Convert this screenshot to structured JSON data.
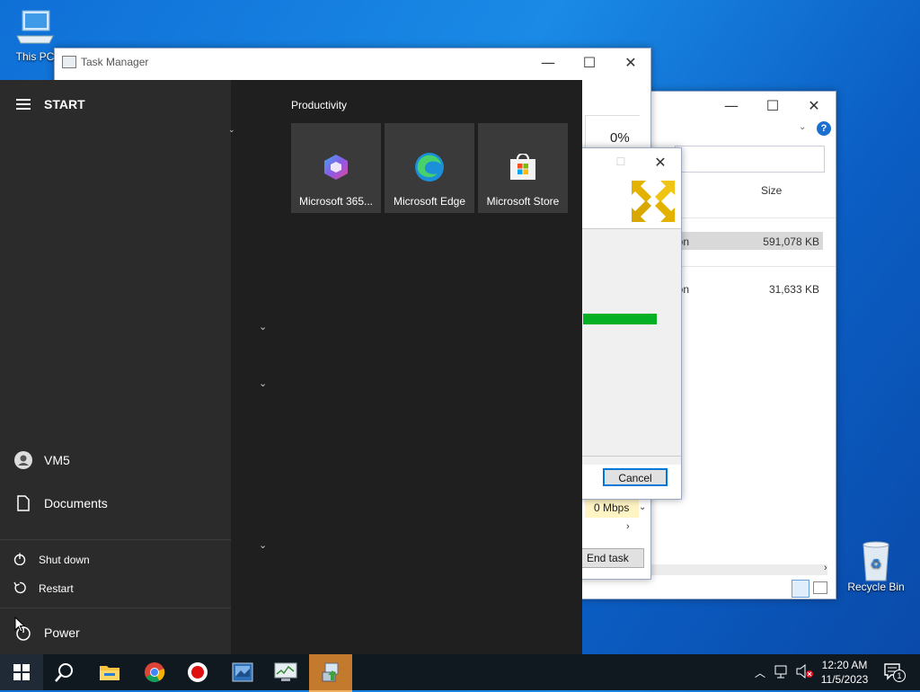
{
  "desktop": {
    "icons": [
      {
        "label": "This PC",
        "icon": "computer-icon"
      },
      {
        "label": "Recycle Bin",
        "icon": "recycle-bin-icon"
      }
    ]
  },
  "task_manager": {
    "title": "Task Manager",
    "cpu_percent": "0%",
    "network": "0 Mbps",
    "end_task_label": "End task"
  },
  "explorer": {
    "column_size": "Size",
    "rows": [
      {
        "type_partial": "cation",
        "size": "591,078 KB"
      },
      {
        "type_partial": "cation",
        "size": "31,633 KB"
      }
    ]
  },
  "dialog": {
    "progress": 1.0,
    "cancel_label": "Cancel",
    "progress_color": "#06b025"
  },
  "start_menu": {
    "header": "START",
    "group_title": "Productivity",
    "tiles": [
      {
        "label": "Microsoft 365...",
        "icon": "microsoft-365-icon"
      },
      {
        "label": "Microsoft Edge",
        "icon": "edge-icon"
      },
      {
        "label": "Microsoft Store",
        "icon": "store-icon"
      }
    ],
    "user": "VM5",
    "documents": "Documents",
    "power_menu": {
      "shutdown": "Shut down",
      "restart": "Restart"
    },
    "power": "Power"
  },
  "taskbar": {
    "time": "12:20 AM",
    "date": "11/5/2023",
    "notification_count": "1",
    "apps": [
      "windows-start-icon",
      "search-icon",
      "file-explorer-icon",
      "chrome-icon",
      "record-icon",
      "app-icon",
      "task-manager-icon",
      "installer-icon"
    ]
  }
}
